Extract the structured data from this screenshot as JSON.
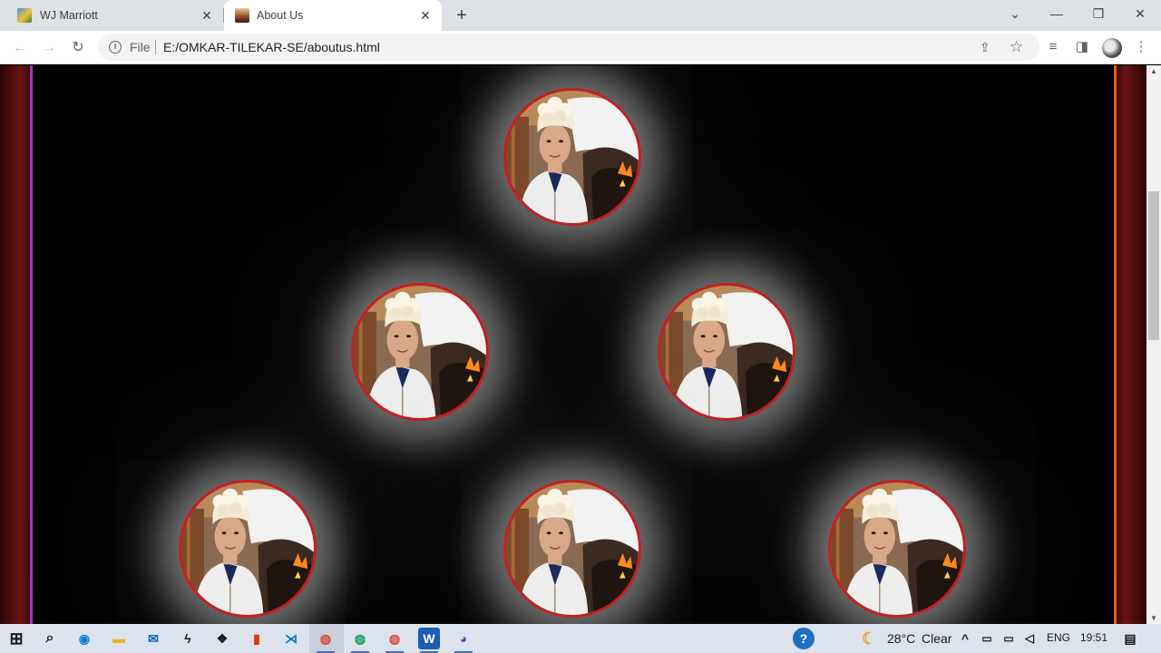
{
  "browser": {
    "tabs": [
      {
        "title": "WJ Marriott",
        "active": false
      },
      {
        "title": "About Us",
        "active": true
      }
    ],
    "new_tab": "+",
    "window_controls": {
      "tab_search": "⌄",
      "minimize": "—",
      "restore": "❐",
      "close": "✕"
    },
    "omnibox": {
      "security_label": "File",
      "url": "E:/OMKAR-TILEKAR-SE/aboutus.html"
    }
  },
  "page": {
    "photos": [
      {
        "alt": "chef-portrait"
      },
      {
        "alt": "chef-portrait"
      },
      {
        "alt": "chef-portrait"
      },
      {
        "alt": "chef-portrait"
      },
      {
        "alt": "chef-portrait"
      },
      {
        "alt": "chef-portrait"
      }
    ],
    "colors": {
      "ring": "#c81e1e",
      "left_edge": "#a032c8",
      "right_edge": "#e85a14"
    }
  },
  "taskbar": {
    "weather": {
      "temperature": "28°C",
      "condition": "Clear"
    },
    "language": "ENG",
    "time": "19:51"
  }
}
